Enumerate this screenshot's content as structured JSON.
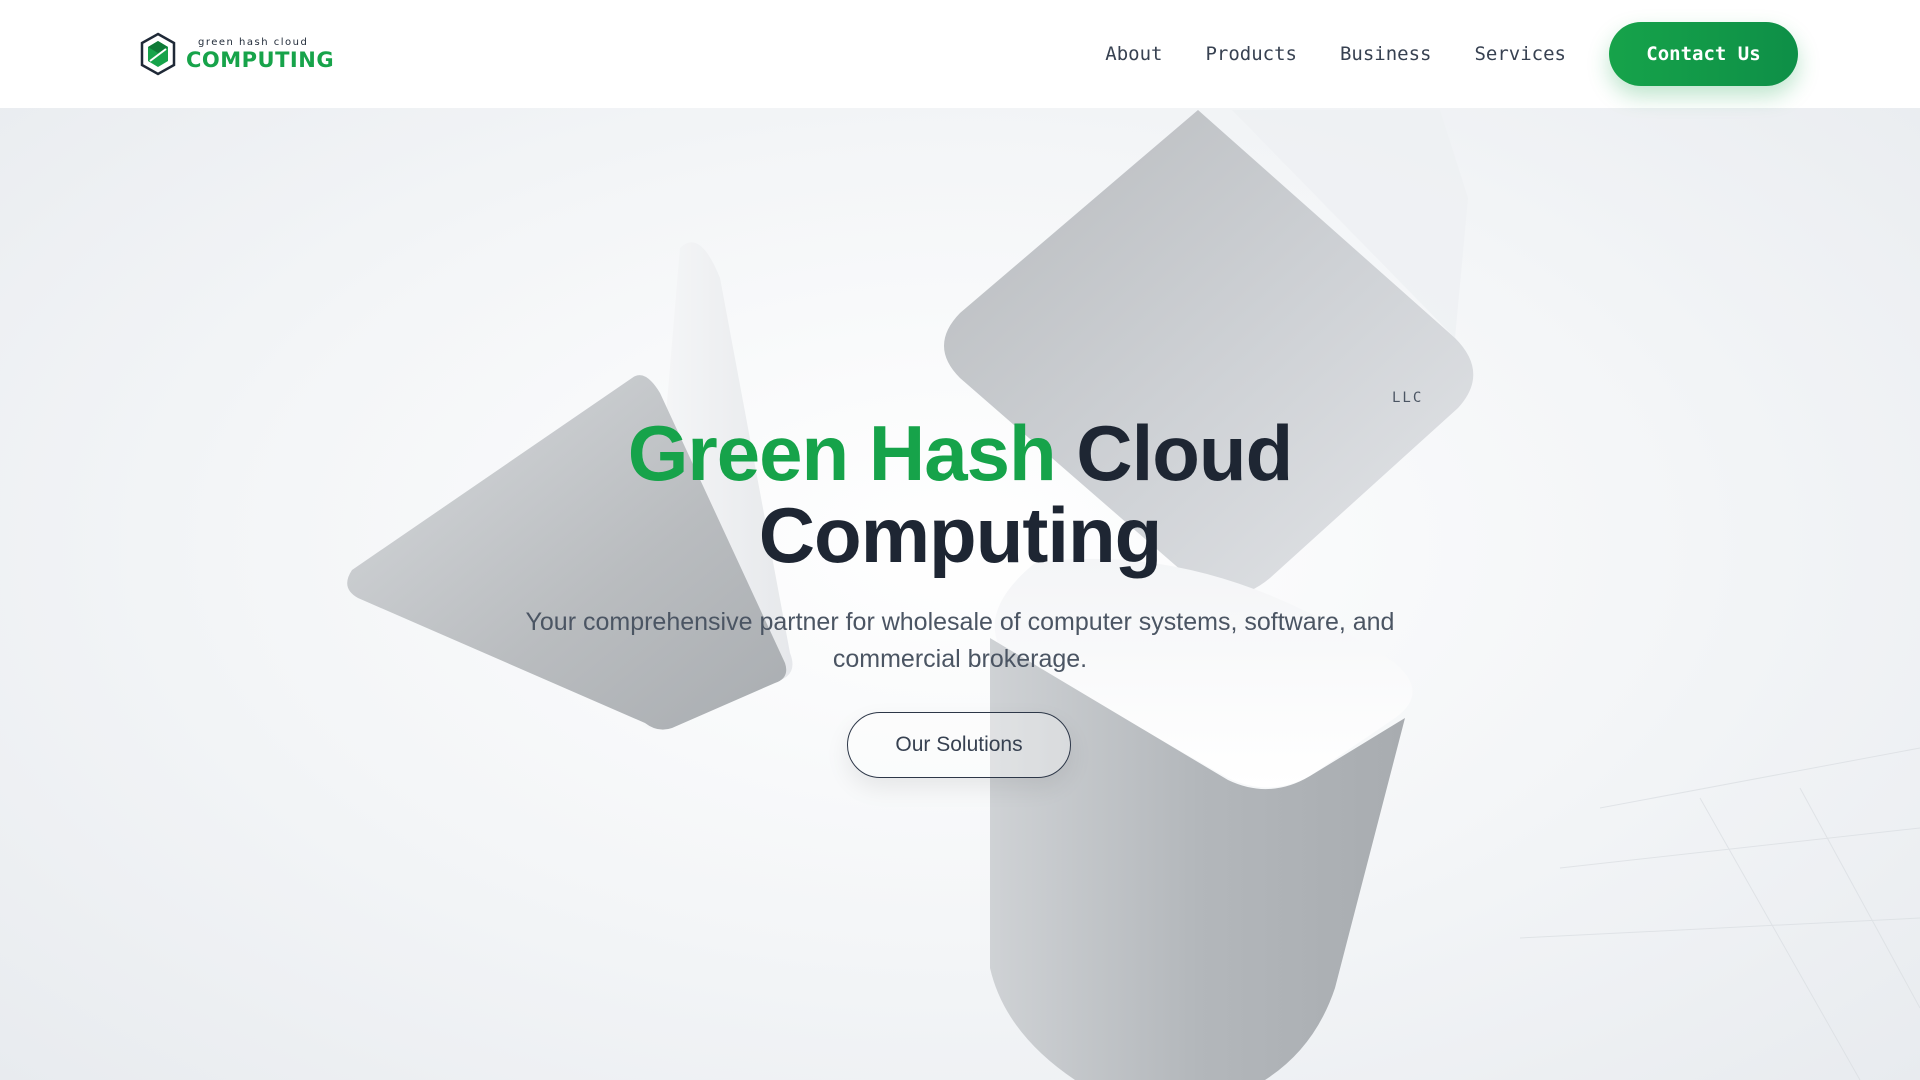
{
  "brand": {
    "logo_small": "green hash cloud",
    "logo_big": "COMPUTING",
    "accent_color": "#16a34a",
    "logo_icon": "hexagon-shield-icon"
  },
  "nav": {
    "items": [
      {
        "label": "About"
      },
      {
        "label": "Products"
      },
      {
        "label": "Business"
      },
      {
        "label": "Services"
      }
    ],
    "contact_label": "Contact Us"
  },
  "hero": {
    "llc_label": "LLC",
    "title_green": "Green Hash",
    "title_rest_1": "Cloud",
    "title_rest_2": "Computing",
    "subtitle": "Your comprehensive partner for wholesale of computer systems, software, and commercial brokerage.",
    "cta_label": "Our Solutions"
  }
}
